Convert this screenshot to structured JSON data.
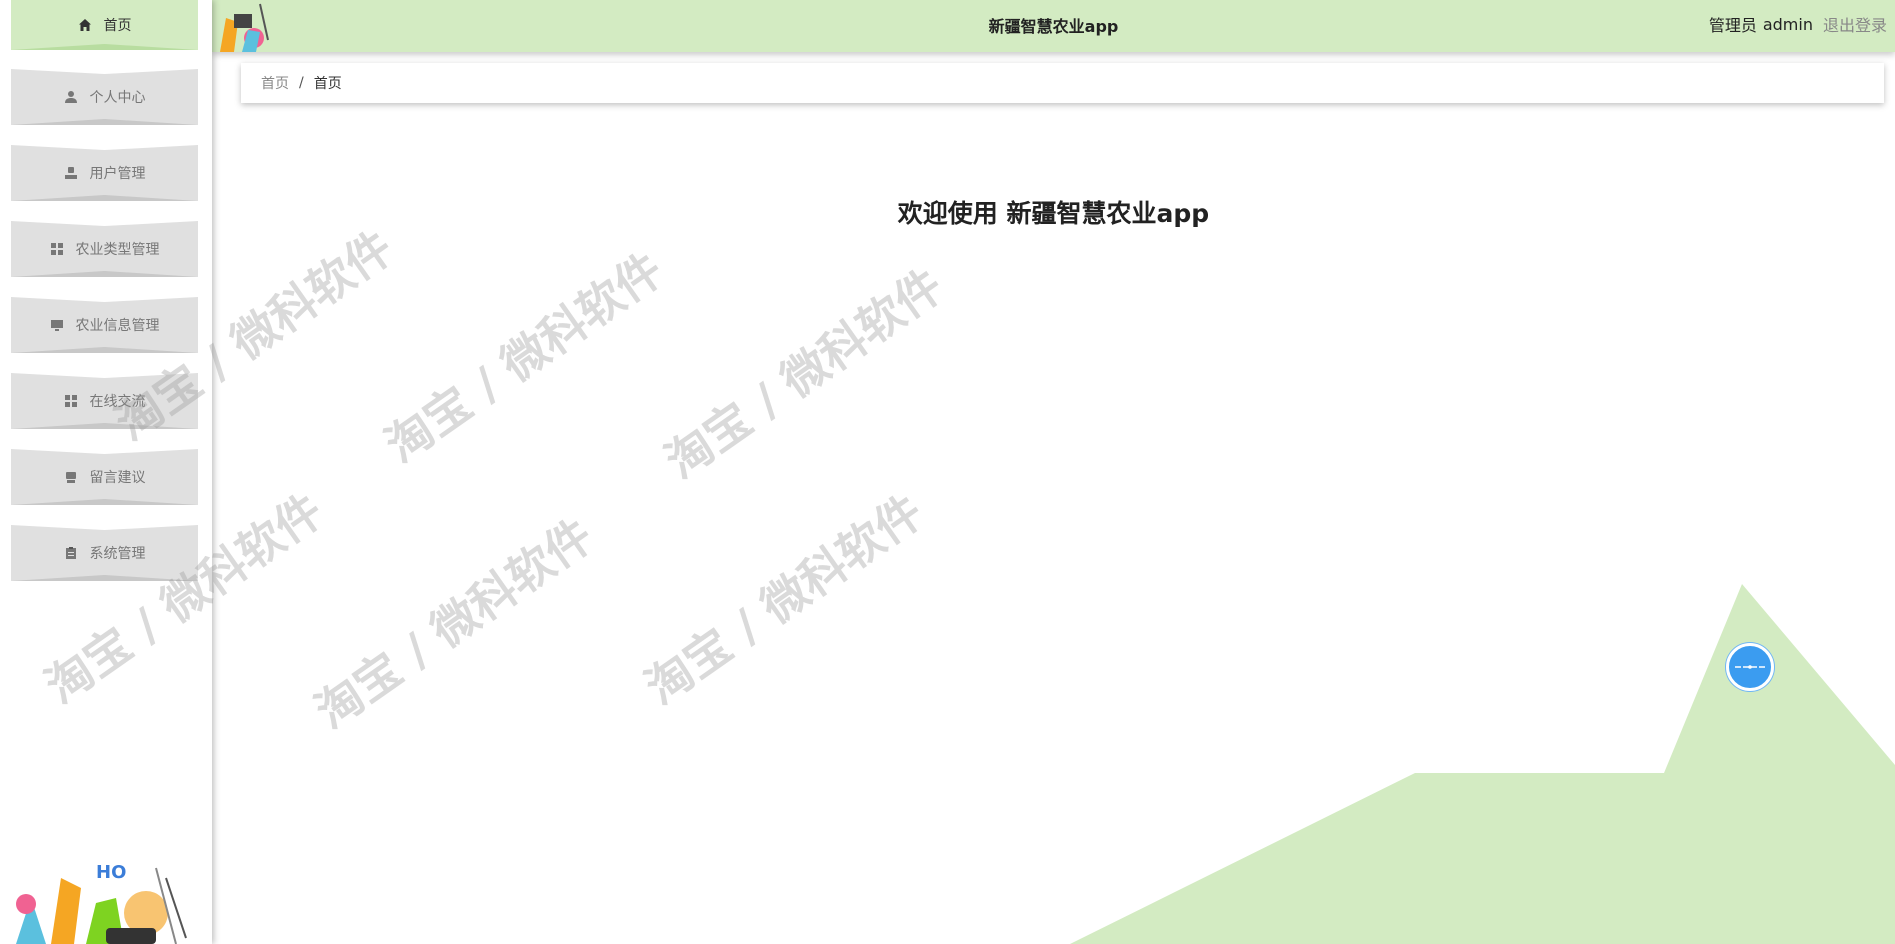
{
  "header": {
    "title": "新疆智慧农业app",
    "user_role": "管理员",
    "user_name": "admin",
    "logout_label": "退出登录"
  },
  "sidebar": {
    "items": [
      {
        "label": "首页",
        "icon": "home-icon",
        "active": true
      },
      {
        "label": "个人中心",
        "icon": "person-icon"
      },
      {
        "label": "用户管理",
        "icon": "user-icon"
      },
      {
        "label": "农业类型管理",
        "icon": "grid-icon"
      },
      {
        "label": "农业信息管理",
        "icon": "monitor-icon"
      },
      {
        "label": "在线交流",
        "icon": "grid-icon"
      },
      {
        "label": "留言建议",
        "icon": "printer-icon"
      },
      {
        "label": "系统管理",
        "icon": "clipboard-icon"
      }
    ]
  },
  "breadcrumb": {
    "items": [
      "首页",
      "首页"
    ],
    "separator": "/"
  },
  "main": {
    "welcome_prefix": "欢迎使用",
    "welcome_app": "新疆智慧农业app"
  },
  "watermark": {
    "text": "淘宝 / 微科软件"
  },
  "colors": {
    "accent_green": "#d3ebc2",
    "menu_gray": "#e0e0e0",
    "chat_blue": "#3b9cf0"
  }
}
